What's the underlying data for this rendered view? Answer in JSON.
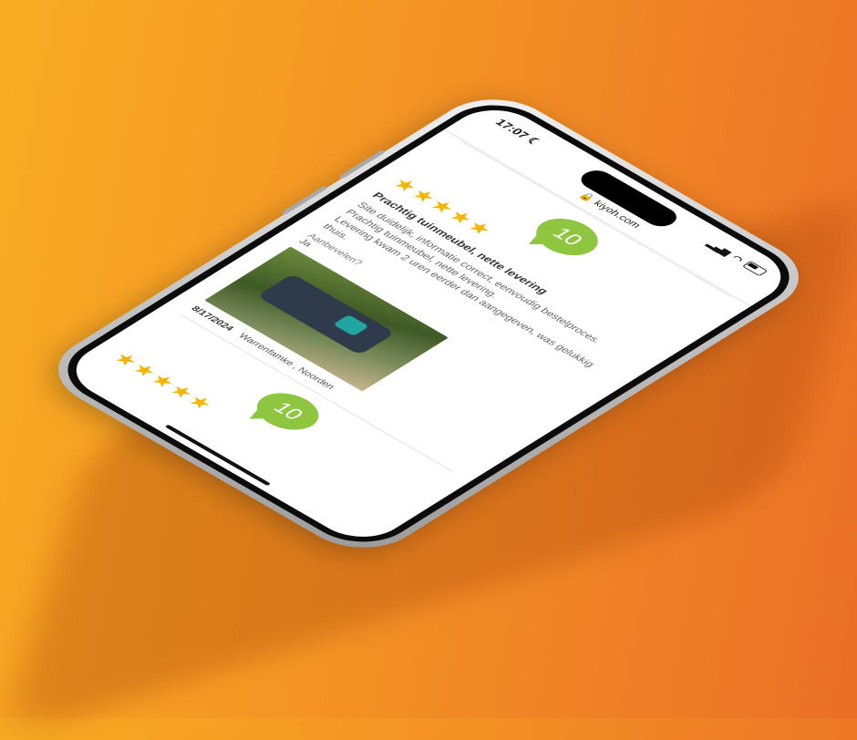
{
  "status_bar": {
    "time": "17:07 ☾"
  },
  "browser": {
    "url": "🔒 kiyoh.com"
  },
  "reviews": [
    {
      "score": "10",
      "stars": "★★★★★",
      "title": "Prachtig tuinmeubel, nette levering",
      "body": "Site duidelijk, informatie correct, eenvoudig bestelproces.\nPrachtig tuinmeubel, nette levering.\nLevering kwam 2 uren eerder dan aangegeven, was gelukkig thuis.",
      "recommend_label": "Aanbevelen?",
      "recommend_value": "Ja",
      "date": "8/17/2024",
      "author": "Warrenfamke , Noorden"
    },
    {
      "score": "10",
      "stars": "★★★★★"
    }
  ],
  "colors": {
    "score_green": "#8ec63f",
    "star_yellow": "#f5b400",
    "background": "#f39324"
  }
}
